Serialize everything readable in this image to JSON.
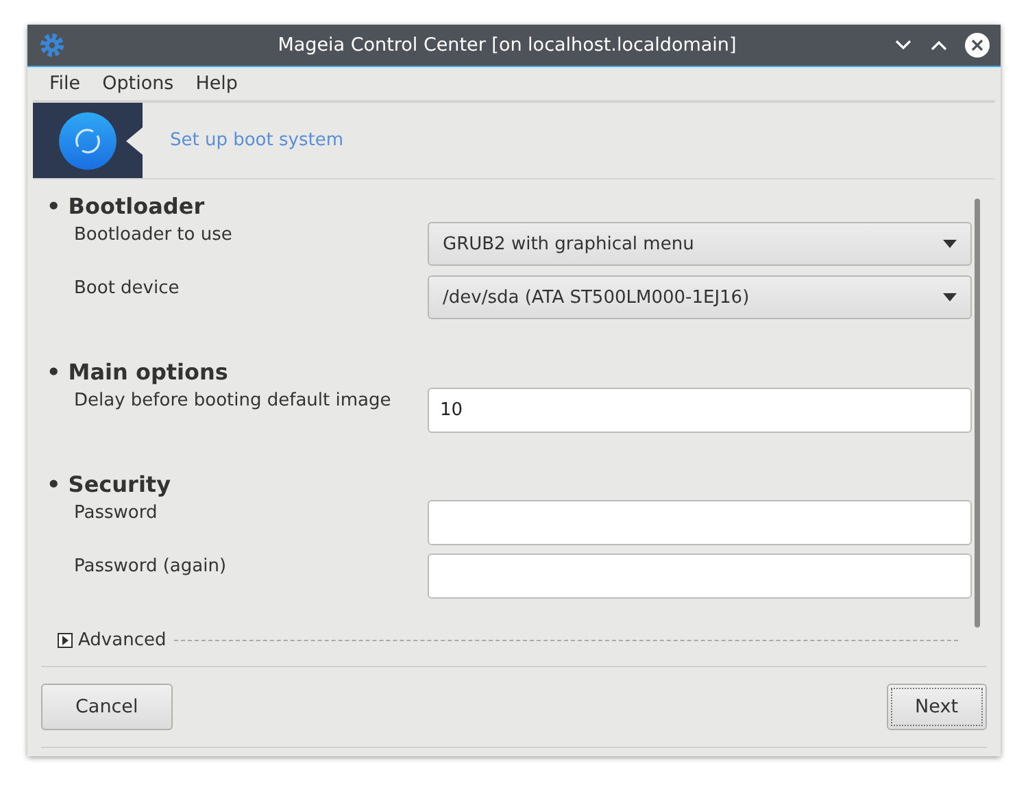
{
  "window": {
    "title": "Mageia Control Center [on localhost.localdomain]"
  },
  "menu": [
    "File",
    "Options",
    "Help"
  ],
  "banner": {
    "title": "Set up boot system"
  },
  "sections": [
    {
      "title": "• Bootloader",
      "fields": [
        {
          "label": "Bootloader to use",
          "kind": "dropdown",
          "value": "GRUB2 with graphical menu"
        },
        {
          "label": "Boot device",
          "kind": "dropdown",
          "value": "/dev/sda (ATA ST500LM000-1EJ16)"
        }
      ]
    },
    {
      "title": "• Main options",
      "fields": [
        {
          "label": "Delay before booting default image",
          "kind": "text",
          "value": "10"
        }
      ]
    },
    {
      "title": "• Security",
      "fields": [
        {
          "label": "Password",
          "kind": "password"
        },
        {
          "label": "Password (again)",
          "kind": "password"
        }
      ]
    }
  ],
  "advanced": {
    "label": "Advanced",
    "expanded": false
  },
  "buttons": {
    "cancel": "Cancel",
    "next": "Next"
  }
}
